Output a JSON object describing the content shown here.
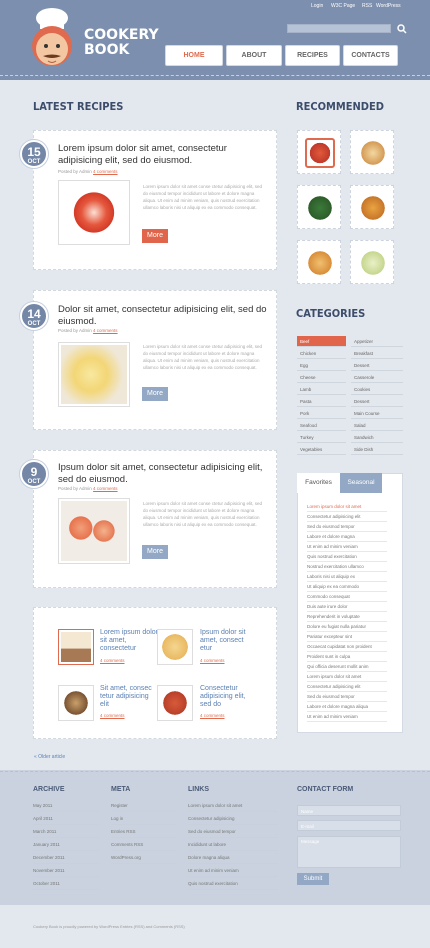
{
  "header": {
    "logo_line1": "COOKERY",
    "logo_line2": "BOOK",
    "top_links": [
      "Login",
      "W3C Page",
      "RSS",
      "WordPress"
    ],
    "search_icon": "search-icon",
    "nav": [
      "HOME",
      "ABOUT",
      "RECIPES",
      "CONTACTS"
    ]
  },
  "latest": {
    "title": "LATEST RECIPES",
    "posts": [
      {
        "day": "15",
        "month": "OCT",
        "title": "Lorem ipsum dolor sit amet, consectetur adipisicing elit, sed do eiusmod.",
        "posted": "Posted by Admin",
        "comments": "4 comments",
        "excerpt": "Lorem ipsum dolor sit amet conse ctetur adipisicing elit, sed do eiusmod tempor incididunt ut labore et dolore magna aliqua. Ut enim ad minim veniam, quis nostrud exercitation ullamco laboris nisi ut aliquip ex ea commodo consequat.",
        "more": "More"
      },
      {
        "day": "14",
        "month": "OCT",
        "title": "Dolor sit amet, consectetur adipisicing elit, sed do eiusmod.",
        "posted": "Posted by Admin",
        "comments": "4 comments",
        "excerpt": "Lorem ipsum dolor sit amet conse ctetur adipisicing elit, sed do eiusmod tempor incididunt ut labore et dolore magna aliqua. Ut enim ad minim veniam, quis nostrud exercitation ullamco laboris nisi ut aliquip ex ea commodo consequat.",
        "more": "More"
      },
      {
        "day": "9",
        "month": "OCT",
        "title": "Ipsum dolor sit amet, consectetur adipisicing elit, sed do eiusmod.",
        "posted": "Posted by Admin",
        "comments": "4 comments",
        "excerpt": "Lorem ipsum dolor sit amet conse ctetur adipisicing elit, sed do eiusmod tempor incididunt ut labore et dolore magna aliqua. Ut enim ad minim veniam, quis nostrud exercitation ullamco laboris nisi ut aliquip ex ea commodo consequat.",
        "more": "More"
      }
    ],
    "grid": [
      {
        "title": "Lorem ipsum dolor sit amet, consectetur",
        "comments": "4 comments"
      },
      {
        "title": "Ipsum dolor sit amet, consect etur",
        "comments": "4 comments"
      },
      {
        "title": "Sit amet, consec tetur adipisicing elit",
        "comments": "4 comments"
      },
      {
        "title": "Consectetur adipisicing elit, sed do",
        "comments": "4 comments"
      }
    ],
    "older": "« Older article"
  },
  "sidebar": {
    "recommended_title": "RECOMMENDED",
    "categories_title": "CATEGORIES",
    "categories_left": [
      "Beef",
      "Chicken",
      "Egg",
      "Cheese",
      "Lamb",
      "Pasta",
      "Pork",
      "Seafood",
      "Turkey",
      "Vegetables"
    ],
    "categories_right": [
      "Appetizer",
      "Breakfast",
      "Dessert",
      "Casserole",
      "Cookies",
      "Dessert",
      "Main Course",
      "Salad",
      "Sandwich",
      "Side Dish"
    ],
    "tabs": [
      "Favorites",
      "Seasonal"
    ],
    "favorites": [
      "Lorem ipsum dolor sit amet",
      "Consectetur adipisicing elit",
      "Sed do eiusmod tempor",
      "Labore et dolore magna",
      "Ut enim ad minim veniam",
      "Quis nostrud exercitation",
      "Nostrud exercitation ullamco",
      "Laboris nisi ut aliquip ex",
      "Ut aliquip ex ea commodo",
      "Commodo consequat",
      "Duis aute irure dolor",
      "Reprehenderit in voluptate",
      "Dolore eu fugiat nulla pariatur",
      "Pariatur excepteur sint",
      "Occaecat cupidatat non proident",
      "Proident sunt in culpa",
      "Qui officia deserunt mollit anim",
      "Lorem ipsum dolor sit amet",
      "Consectetur adipisicing elit",
      "Sed do eiusmod tempor",
      "Labore et dolore magna aliqua",
      "Ut enim ad minim veniam"
    ]
  },
  "footer": {
    "archive_title": "ARCHIVE",
    "archive": [
      "May 2011",
      "April 2011",
      "March 2011",
      "January 2011",
      "December 2011",
      "November 2011",
      "October 2011"
    ],
    "meta_title": "META",
    "meta": [
      "Register",
      "Log in",
      "Entries RSS",
      "Comments RSS",
      "WordPress.org"
    ],
    "links_title": "LINKS",
    "links": [
      "Lorem ipsum dolor sit amet",
      "Consectetur adipisicing",
      "Sed do eiusmod tempor",
      "Incididunt ut labore",
      "Dolore magna aliqua",
      "Ut enim ad minim veniam",
      "Quis nostrud exercitation"
    ],
    "contact_title": "CONTACT FORM",
    "name_ph": "Name",
    "email_ph": "E-mail",
    "message_ph": "Message",
    "submit": "Submit",
    "copyright": "Cookery Book is proudly powered by WordPress  Entries (RSS) and Comments (RSS)"
  }
}
